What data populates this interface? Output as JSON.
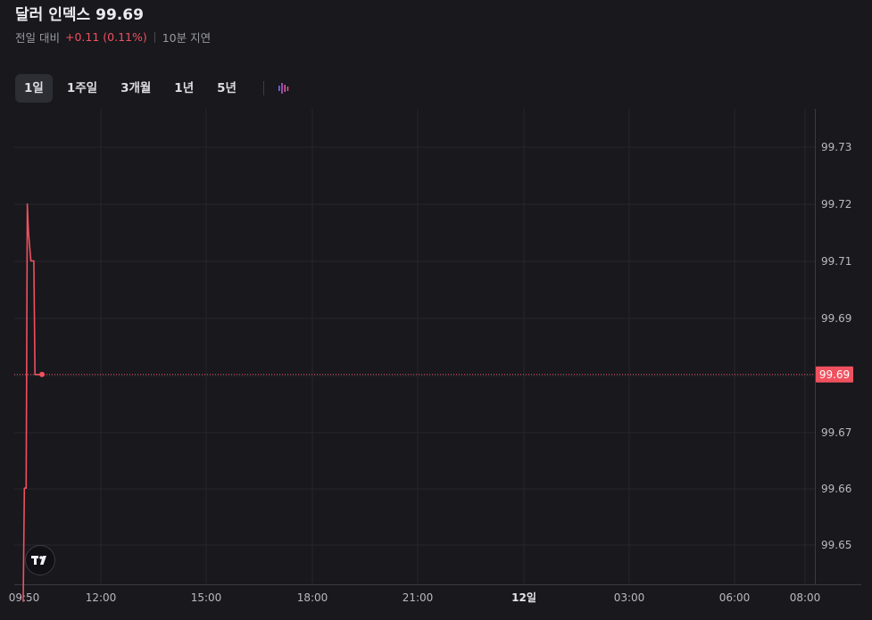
{
  "header": {
    "title": "달러 인덱스",
    "price": "99.69",
    "change_label": "전일 대비",
    "change": "+0.11 (0.11%)",
    "delay": "10분 지연"
  },
  "tabs": [
    {
      "label": "1일",
      "active": true
    },
    {
      "label": "1주일",
      "active": false
    },
    {
      "label": "3개월",
      "active": false
    },
    {
      "label": "1년",
      "active": false
    },
    {
      "label": "5년",
      "active": false
    }
  ],
  "icons": {
    "chart_type": "candlestick-chart-icon",
    "logo": "tradingview-logo-icon"
  },
  "colors": {
    "background": "#18181d",
    "line": "#f0515f",
    "grid": "#26262d",
    "axis_text": "#b9b9c0"
  },
  "chart_data": {
    "type": "line",
    "x_ticks": [
      "09:50",
      "12:00",
      "15:00",
      "18:00",
      "21:00",
      "12일",
      "03:00",
      "06:00",
      "08:00"
    ],
    "y_ticks": [
      "99.73",
      "99.72",
      "99.71",
      "99.69",
      "99.67",
      "99.66",
      "99.65"
    ],
    "ylim": [
      99.65,
      99.73
    ],
    "last_value_label": "99.69",
    "series": [
      {
        "x": [
          "09:50",
          "09:52",
          "09:55",
          "09:57",
          "09:59",
          "10:03",
          "10:05",
          "10:08",
          "10:10",
          "10:20",
          "10:22"
        ],
        "values": [
          99.65,
          99.67,
          99.67,
          99.72,
          99.715,
          99.71,
          99.71,
          99.71,
          99.69,
          99.69,
          99.69
        ]
      }
    ],
    "grid": true
  }
}
